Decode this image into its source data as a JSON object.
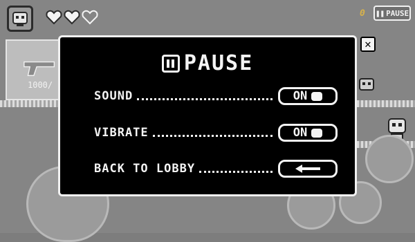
{
  "hud": {
    "coin_count": "0",
    "pause_label": "PAUSE",
    "hearts": [
      "full",
      "full",
      "empty"
    ]
  },
  "weapon": {
    "ammo": "1000/"
  },
  "dialog": {
    "title": "PAUSE",
    "rows": [
      {
        "label": "SOUND",
        "value": "ON"
      },
      {
        "label": "VIBRATE",
        "value": "ON"
      },
      {
        "label": "BACK TO LOBBY"
      }
    ],
    "close_glyph": "✕"
  }
}
